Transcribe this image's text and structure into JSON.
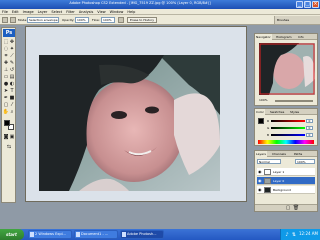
{
  "window": {
    "title": "Adobe Photoshop CS2 Extended - [IMG_7519 ZZ.jpg @ 100% (Layer 0, RGB/8#)]"
  },
  "menu": [
    "File",
    "Edit",
    "Image",
    "Layer",
    "Select",
    "Filter",
    "Analysis",
    "View",
    "Window",
    "Help"
  ],
  "options": {
    "mode_label": "Mode:",
    "mode_value": "Selection envelope",
    "opacity_label": "Opacity:",
    "opacity_value": "100%",
    "flow_label": "Flow:",
    "flow_value": "100%",
    "erase_label": "Erase to History"
  },
  "brushes_tab": "Brushes",
  "tools_badge": "Ps",
  "colors": {
    "accent": "#1c5fc1",
    "foreground": "#000000",
    "background": "#ffffff",
    "selected_layer": "#316ac5"
  },
  "navigator": {
    "tabs": [
      "Navigator",
      "Histogram",
      "Info"
    ],
    "zoom": "100%"
  },
  "color_panel": {
    "tabs": [
      "Color",
      "Swatches",
      "Styles"
    ],
    "channels": [
      {
        "label": "R",
        "value": "0"
      },
      {
        "label": "G",
        "value": "0"
      },
      {
        "label": "B",
        "value": "0"
      }
    ]
  },
  "layers_panel": {
    "tabs": [
      "Layers",
      "Channels",
      "Paths"
    ],
    "blend": "Normal",
    "opacity": "100%",
    "layers": [
      {
        "name": "Layer 1",
        "selected": false
      },
      {
        "name": "Layer 0",
        "selected": true
      },
      {
        "name": "Background",
        "selected": false
      }
    ]
  },
  "taskbar": {
    "start": "start",
    "tasks": [
      "2 Windows Expl...",
      "Document1 - ...",
      "Adobe Photosh..."
    ],
    "clock": "12:24 AM"
  }
}
